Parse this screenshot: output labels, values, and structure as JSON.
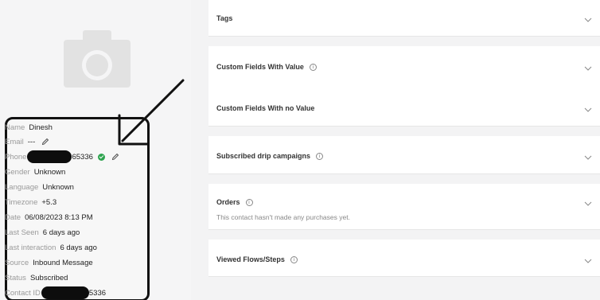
{
  "profile": {
    "name": {
      "label": "Name",
      "value": "Dinesh"
    },
    "email": {
      "label": "Email",
      "value": "---"
    },
    "phone": {
      "label": "Phone",
      "value": "65336"
    },
    "gender": {
      "label": "Gender",
      "value": "Unknown"
    },
    "language": {
      "label": "Language",
      "value": "Unknown"
    },
    "timezone": {
      "label": "Timezone",
      "value": "+5.3"
    },
    "date": {
      "label": "Date",
      "value": "06/08/2023 8:13 PM"
    },
    "last_seen": {
      "label": "Last Seen",
      "value": "6 days ago"
    },
    "last_interaction": {
      "label": "Last interaction",
      "value": "6 days ago"
    },
    "source": {
      "label": "Source",
      "value": "Inbound Message"
    },
    "status": {
      "label": "Status",
      "value": "Subscribed"
    },
    "contact_id": {
      "label": "Contact ID",
      "value": "5336"
    }
  },
  "sections": {
    "tags": {
      "title": "Tags"
    },
    "custom_fields_value": {
      "title": "Custom Fields With Value"
    },
    "custom_fields_no_value": {
      "title": "Custom Fields With no Value"
    },
    "drip_campaigns": {
      "title": "Subscribed drip campaigns"
    },
    "orders": {
      "title": "Orders",
      "subtitle": "This contact hasn't made any purchases yet."
    },
    "viewed_flows": {
      "title": "Viewed Flows/Steps"
    }
  },
  "icons": {
    "info": "i",
    "verified": "check-circle-icon",
    "pencil": "pencil-icon",
    "chevron": "chevron-down-icon",
    "avatar": "camera-icon"
  },
  "colors": {
    "verified": "#2ea44f",
    "background": "#f3f3f4",
    "card": "#ffffff",
    "annotation": "#111111"
  }
}
